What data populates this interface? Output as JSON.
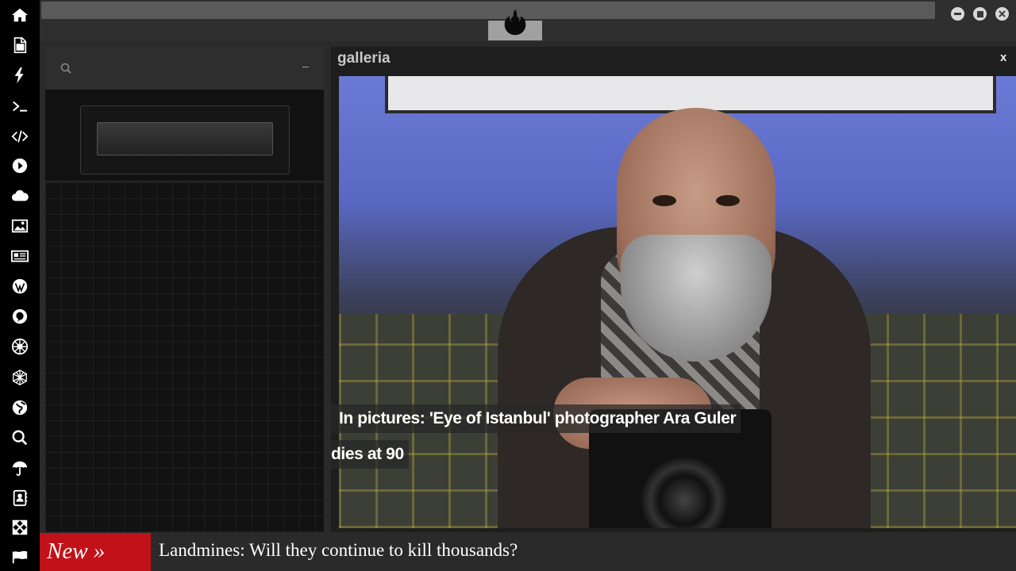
{
  "sidebar": {
    "icons": [
      {
        "name": "home-icon"
      },
      {
        "name": "document-icon"
      },
      {
        "name": "bolt-icon"
      },
      {
        "name": "terminal-icon"
      },
      {
        "name": "code-icon"
      },
      {
        "name": "play-icon"
      },
      {
        "name": "cloud-icon"
      },
      {
        "name": "image-icon"
      },
      {
        "name": "newspaper-icon"
      },
      {
        "name": "wordpress-icon"
      },
      {
        "name": "pinterest-icon"
      },
      {
        "name": "empire-icon"
      },
      {
        "name": "geodesic-icon"
      },
      {
        "name": "globe-icon"
      },
      {
        "name": "search-icon"
      },
      {
        "name": "umbrella-icon"
      },
      {
        "name": "contacts-icon"
      },
      {
        "name": "expand-icon"
      },
      {
        "name": "flag-icon"
      }
    ]
  },
  "topbar": {
    "logo": "rebel-alliance-logo",
    "window_controls": [
      "minimize",
      "maximize",
      "close"
    ]
  },
  "search": {
    "collapse_label": "–",
    "input_value": ""
  },
  "gallery": {
    "title": "galleria",
    "close_label": "x",
    "caption_line1": "In pictures: 'Eye of Istanbul' photographer Ara Guler",
    "caption_line2": "dies at 90"
  },
  "ticker": {
    "badge": "New »",
    "headline": "Landmines: Will they continue to kill thousands?"
  }
}
